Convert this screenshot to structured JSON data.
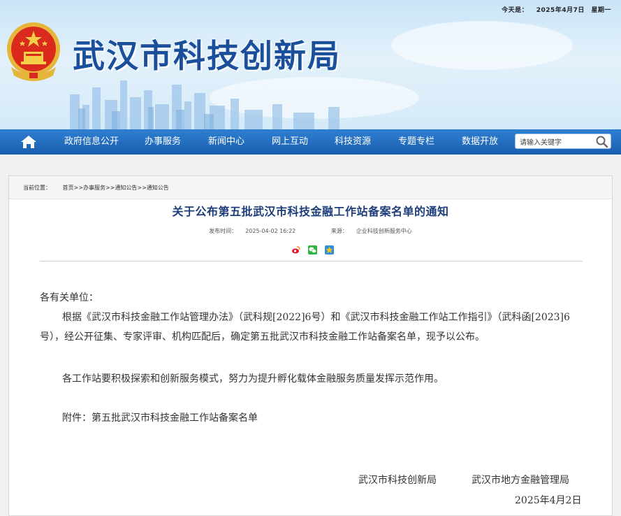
{
  "header": {
    "date_label": "今天是：",
    "date_value": "2025年4月7日",
    "weekday": "星期一",
    "site_title": "武汉市科技创新局"
  },
  "nav": {
    "items": [
      "政府信息公开",
      "办事服务",
      "新闻中心",
      "网上互动",
      "科技资源",
      "专题专栏",
      "数据开放"
    ],
    "search_placeholder": "请输入关键字"
  },
  "breadcrumb": {
    "label": "当前位置：",
    "items": [
      "首页",
      "办事服务",
      "通知公告",
      "通知公告"
    ],
    "separator": ">>"
  },
  "article": {
    "title": "关于公布第五批武汉市科技金融工作站备案名单的通知",
    "publish_label": "发布时间：",
    "publish_time": "2025-04-02 16:22",
    "source_label": "来源：",
    "source": "企业科技创新服务中心",
    "greeting": "各有关单位：",
    "paragraph1": "根据《武汉市科技金融工作站管理办法》（武科规[2022]6号）和《武汉市科技金融工作站工作指引》（武科函[2023]6号），经公开征集、专家评审、机构匹配后，确定第五批武汉市科技金融工作站备案名单，现予以公布。",
    "paragraph2": "各工作站要积极探索和创新服务模式，努力为提升孵化载体金融服务质量发挥示范作用。",
    "attachment_label": "附件：",
    "attachment_link": "第五批武汉市科技金融工作站备案名单",
    "signer1": "武汉市科技创新局",
    "signer2": "武汉市地方金融管理局",
    "sign_date": "2025年4月2日"
  },
  "colors": {
    "nav_bg": "#1a5eae",
    "title_blue": "#1a4f9c",
    "article_title": "#1d3d7a"
  }
}
